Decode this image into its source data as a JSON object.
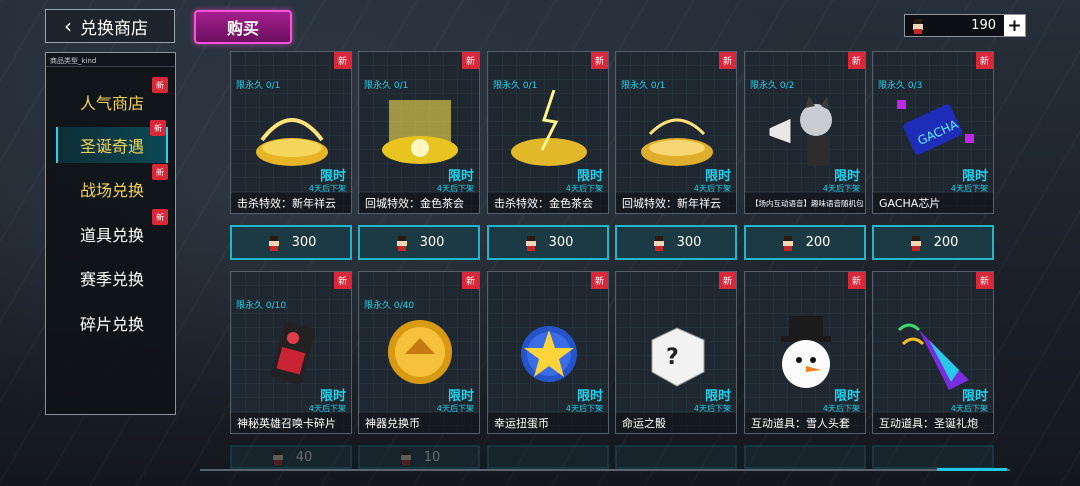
{
  "header": {
    "back_label": "兑换商店",
    "buy_tab": "购买",
    "currency_amount": "190",
    "currency_plus": "+"
  },
  "sidebar": {
    "head": "商品类型_kind",
    "items": [
      {
        "label": "人气商店",
        "new": "新"
      },
      {
        "label": "圣诞奇遇",
        "new": "新"
      },
      {
        "label": "战场兑换",
        "new": "新"
      },
      {
        "label": "道具兑换",
        "new": "新"
      },
      {
        "label": "赛季兑换"
      },
      {
        "label": "碎片兑换"
      }
    ]
  },
  "cards": [
    {
      "limit": "限永久 0/1",
      "timed": "限时",
      "shelf": "4天后下架",
      "name": "击杀特效：新年祥云",
      "new": "新",
      "price": "300",
      "art": "golden-halo-ring"
    },
    {
      "limit": "限永久 0/1",
      "timed": "限时",
      "shelf": "4天后下架",
      "name": "回城特效：金色茶会",
      "new": "新",
      "price": "300",
      "art": "golden-flower-pedestal"
    },
    {
      "limit": "限永久 0/1",
      "timed": "限时",
      "shelf": "4天后下架",
      "name": "击杀特效：金色茶会",
      "new": "新",
      "price": "300",
      "art": "golden-lightning-pedestal"
    },
    {
      "limit": "限永久 0/1",
      "timed": "限时",
      "shelf": "4天后下架",
      "name": "回城特效：新年祥云",
      "new": "新",
      "price": "300",
      "art": "golden-cloud-ring"
    },
    {
      "limit": "限永久 0/2",
      "timed": "限时",
      "shelf": "4天后下架",
      "name": "【场内互动语音】趣味语音随机包",
      "new": "新",
      "price": "200",
      "art": "megaphone-cat-girl"
    },
    {
      "limit": "限永久 0/3",
      "timed": "限时",
      "shelf": "4天后下架",
      "name": "GACHA芯片",
      "new": "新",
      "price": "200",
      "art": "gacha-chip"
    },
    {
      "limit": "限永久 0/10",
      "timed": "限时",
      "shelf": "4天后下架",
      "name": "神秘英雄召唤卡碎片",
      "new": "新",
      "price": "40",
      "art": "summon-card"
    },
    {
      "limit": "限永久 0/40",
      "timed": "限时",
      "shelf": "4天后下架",
      "name": "神器兑换币",
      "new": "新",
      "price": "10",
      "art": "artifact-coin"
    },
    {
      "limit": "",
      "timed": "限时",
      "shelf": "4天后下架",
      "name": "幸运扭蛋币",
      "new": "新",
      "price": "",
      "art": "star-token"
    },
    {
      "limit": "",
      "timed": "限时",
      "shelf": "4天后下架",
      "name": "命运之骰",
      "new": "新",
      "price": "",
      "art": "fate-dice"
    },
    {
      "limit": "",
      "timed": "限时",
      "shelf": "4天后下架",
      "name": "互动道具：雪人头套",
      "new": "新",
      "price": "",
      "art": "snowman-head"
    },
    {
      "limit": "",
      "timed": "限时",
      "shelf": "4天后下架",
      "name": "互动道具：圣诞礼炮",
      "new": "新",
      "price": "",
      "art": "party-popper"
    }
  ],
  "colors": {
    "accent": "#1fd4ef",
    "gold": "#f4d257",
    "badge": "#d8283a",
    "magenta": "#ff52d8"
  }
}
